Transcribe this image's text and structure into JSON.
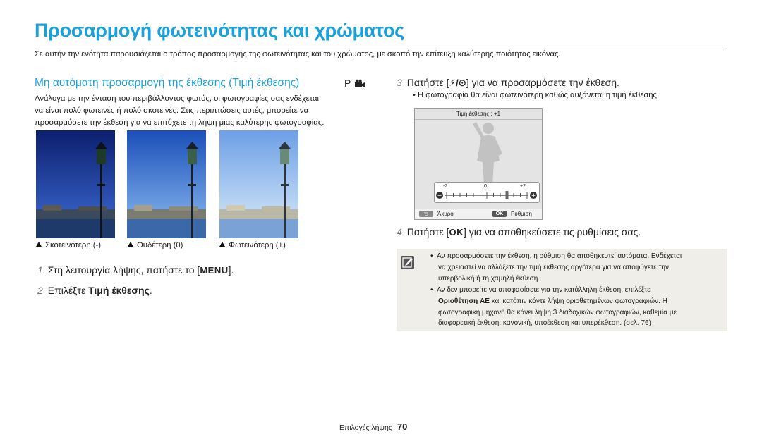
{
  "page": {
    "title": "Προσαρμογή φωτεινότητας και χρώματος",
    "intro": "Σε αυτήν την ενότητα παρουσιάζεται ο τρόπος προσαρμογής της φωτεινότητας και του χρώματος, με σκοπό την επίτευξη καλύτερης ποιότητας εικόνας."
  },
  "section": {
    "heading": "Μη αυτόματη προσαρμογή της έκθεσης (Τιμή έκθεσης)",
    "mode_icons": [
      "P",
      "movie-camera-icon"
    ],
    "paragraph_lines": [
      "Ανάλογα με την ένταση του περιβάλλοντος φωτός, οι φωτογραφίες σας ενδέχεται",
      "να είναι πολύ φωτεινές ή πολύ σκοτεινές. Στις περιπτώσεις αυτές, μπορείτε να",
      "προσαρμόσετε την έκθεση για να επιτύχετε τη λήψη μιας καλύτερης φωτογραφίας."
    ],
    "photos": [
      {
        "caption": "Σκοτεινότερη (-)"
      },
      {
        "caption": "Ουδέτερη (0)"
      },
      {
        "caption": "Φωτεινότερη (+)"
      }
    ]
  },
  "steps": {
    "s1": {
      "num": "1",
      "text": "Στη λειτουργία λήψης, πατήστε το [",
      "key": "MENU",
      "end": "]."
    },
    "s2": {
      "num": "2",
      "text": "Επιλέξτε ",
      "bold": "Τιμή έκθεσης",
      "end": "."
    },
    "s3": {
      "num": "3",
      "text": "Πατήστε [",
      "key": "⚡/⏲",
      "end": "] για να προσαρμόσετε την έκθεση.",
      "bullet": "Η φωτογραφία θα είναι φωτεινότερη καθώς αυξάνεται η τιμή έκθεσης."
    },
    "s4": {
      "num": "4",
      "text": "Πατήστε [",
      "key": "OK",
      "end": "] για να αποθηκεύσετε τις ρυθμίσεις σας."
    }
  },
  "camera_screen": {
    "label": "Τιμή έκθεσης : +1",
    "value": 1,
    "ticks": [
      "-2",
      "0",
      "+2"
    ],
    "back_label": "Άκυρο",
    "ok_key": "OK",
    "ok_label": "Ρύθμιση"
  },
  "notes": {
    "n1": [
      "Αν προσαρμόσετε την έκθεση, η ρύθμιση θα αποθηκευτεί αυτόματα. Ενδέχεται",
      "να χρειαστεί να αλλάξετε την τιμή έκθεσης αργότερα για να αποφύγετε την",
      "υπερβολική ή τη χαμηλή έκθεση."
    ],
    "n2_line1": "Αν δεν μπορείτε να αποφασίσετε για την κατάλληλη έκθεση, επιλέξτε",
    "n2_bold": "Οριοθέτηση AE",
    "n2_rest": " και κατόπιν κάντε λήψη οριοθετημένων φωτογραφιών. Η",
    "n2_lines": [
      "φωτογραφική μηχανή θα κάνει λήψη 3 διαδοχικών φωτογραφιών, καθεμία με",
      "διαφορετική έκθεση: κανονική, υποέκθεση και υπερέκθεση. (σελ. 76)"
    ]
  },
  "footer": {
    "label": "Επιλογές λήψης",
    "page": "70"
  }
}
